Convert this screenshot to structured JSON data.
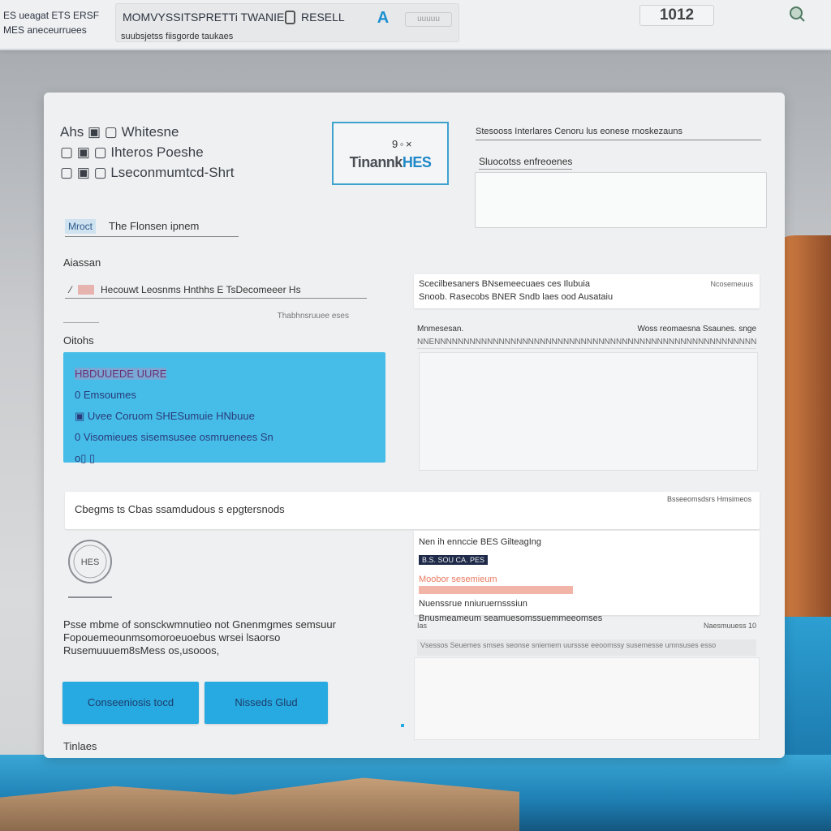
{
  "topbar": {
    "left_line1": "ES ueagat ETS ERSF",
    "left_line2": "MES aneceurruees",
    "field_title": "MOMVYSSITSPRETTi TWANIE",
    "field_action": "RESELL",
    "field_subtitle": "suubsjetss fiisgorde taukaes",
    "logo_glyph": "A",
    "small_button": "uuuuu",
    "counter": "1012",
    "search_icon": "search-icon"
  },
  "window": {
    "header_rows": [
      "Ahs  ▣ ▢  Whitesne",
      "▢ ▣  ▢  Ihteros Poeshe",
      "▢ ▣  ▢  Lseconmumtcd-Shrt"
    ],
    "logo_text_a": "Tinannk",
    "logo_text_b": "HES",
    "logo_small": "9 ◦ ×",
    "right_heading": "Stesooss Interlares Cenoru lus eonese rnoskezauns",
    "right_subheading": "Sluocotss enfreoenes",
    "tab_active": "Mroct",
    "tab_label": "The Flonsen ipnem",
    "label_a": "Aiassan",
    "input_text": "Hecouwt Leosnms Hnthhs E  TsDecomeeer Hs",
    "sub_row": "Thabhnsruuee eses",
    "label_o": "Oitohs",
    "blue_lines": [
      "HBDUUEDE UURE",
      "0  Emsoumes",
      "▣  Uvee  Coruom  SHESumuie  HNbuue",
      "0  Visomieues  sisemsusee  osmruenees  Sn",
      "o▯  ▯"
    ],
    "note_line1": "Scecilbesaners BNsemeecuaes ces Ilubuia",
    "note_line2": "Snoob. Rasecobs BNER Sndb laes ood Ausataiu",
    "note_right": "Ncosemeuus",
    "panel2_left": "Mnmesesan.",
    "panel2_right": "Woss reomaesna Ssaunes. snge",
    "panel2_sub": "NNENNNNNNNNNNNNNNNNNNNNNNNNNNNNNNNNNNNNNNNNNNNNNNNNNNNNNNNN",
    "wide_text": "Cbegms ts Cbas  ssamdudous s epgtersnods",
    "wide_right": "Bsseeomsdsrs Hmsimeos",
    "seal_text": "HES",
    "desc": "Psse mbme of sonsckwmnutieo  not Gnenmgmes semsuur Fopouemeounmsomoroeuoebus  wrsei  lsaorso Rusemuuuem8sMess os,usooos,",
    "btn1": "Conseeniosis tocd",
    "btn2": "Nisseds Glud",
    "footer": "Tinlaes",
    "card_title": "Nen ih ennccie BES GilteagIng",
    "card_pill": "B.S. SOU CA. PES",
    "card_r1": "Moobor sesemieum",
    "card_r3": "Nuenssrue  nniuruernsssiun",
    "card_r4": "Bnusmeameum seamuesomssuemmeeomses",
    "p3_left": "Ias",
    "p3_right": "Naesmuuess  10",
    "p3_sub": "Vsessos Seuemes smses seonse sniemem uurssse eeoomssy susemesse umnsuses esso"
  },
  "colors": {
    "accent": "#27a9e1",
    "panel_blue": "#45bde8",
    "window_bg": "#eff0f1"
  }
}
